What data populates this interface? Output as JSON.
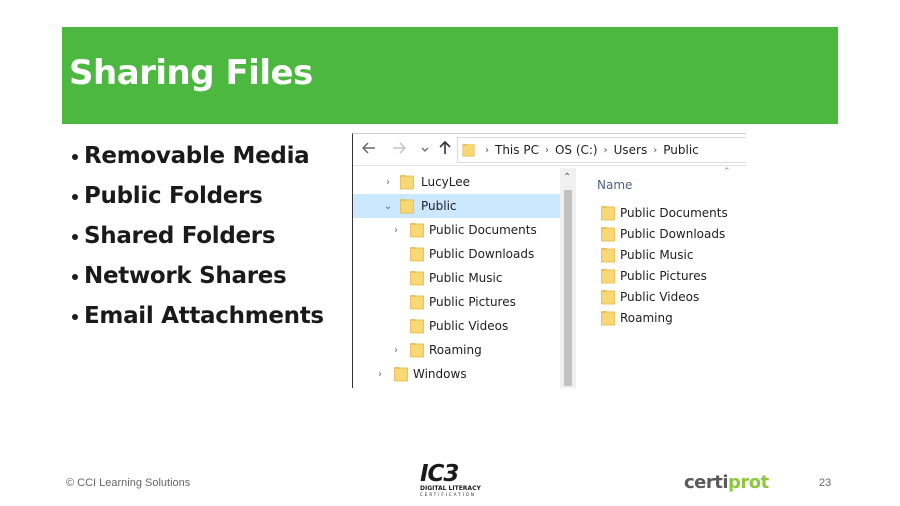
{
  "slide": {
    "title": "Sharing Files",
    "bullets": [
      "Removable Media",
      "Public Folders",
      "Shared Folders",
      "Network Shares",
      "Email Attachments"
    ]
  },
  "explorer": {
    "nav": {
      "back_icon": "arrow-left-icon",
      "forward_icon": "arrow-right-icon",
      "recent_icon": "chevron-down-icon",
      "up_icon": "arrow-up-icon"
    },
    "breadcrumb": [
      "This PC",
      "OS (C:)",
      "Users",
      "Public"
    ],
    "tree": [
      {
        "label": "LucyLee",
        "selected": false,
        "expandable": true,
        "expanded": false
      },
      {
        "label": "Public",
        "selected": true,
        "expandable": true,
        "expanded": true
      },
      {
        "label": "Public Documents",
        "selected": false,
        "expandable": true,
        "expanded": false
      },
      {
        "label": "Public Downloads",
        "selected": false,
        "expandable": false
      },
      {
        "label": "Public Music",
        "selected": false,
        "expandable": false
      },
      {
        "label": "Public Pictures",
        "selected": false,
        "expandable": false
      },
      {
        "label": "Public Videos",
        "selected": false,
        "expandable": false
      },
      {
        "label": "Roaming",
        "selected": false,
        "expandable": true,
        "expanded": false
      },
      {
        "label": "Windows",
        "selected": false,
        "expandable": true,
        "expanded": false
      }
    ],
    "content": {
      "column_header": "Name",
      "items": [
        "Public Documents",
        "Public Downloads",
        "Public Music",
        "Public Pictures",
        "Public Videos",
        "Roaming"
      ]
    }
  },
  "footer": {
    "copyright": "© CCI Learning Solutions",
    "ic3_logo": "IC3",
    "ic3_tagline": "DIGITAL LITERACY",
    "ic3_sub": "CERTIFICATION",
    "certiprot_part1": "certi",
    "certiprot_part2": "prot",
    "page_number": "23"
  },
  "colors": {
    "title_bar": "#4cb840",
    "selection": "#cce8ff",
    "folder": "#f8d775"
  }
}
